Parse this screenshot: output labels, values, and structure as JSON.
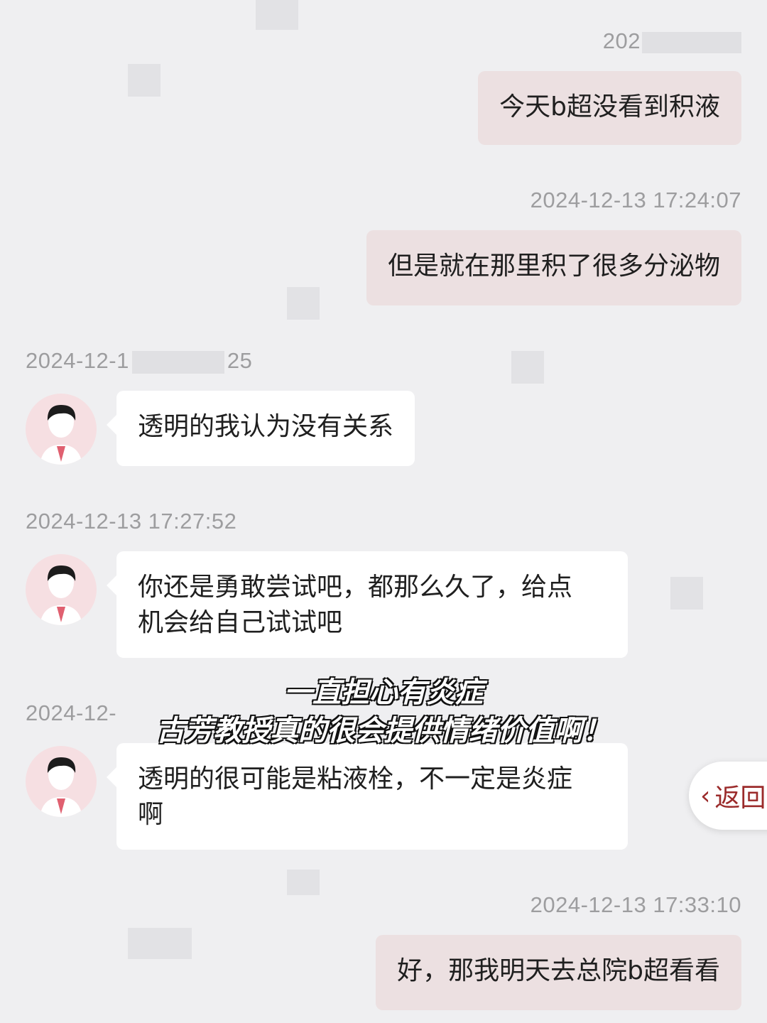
{
  "messages": [
    {
      "timestamp": "202",
      "side": "sent",
      "text": "今天b超没看到积液"
    },
    {
      "timestamp": "2024-12-13 17:24:07",
      "side": "sent",
      "text": "但是就在那里积了很多分泌物"
    },
    {
      "timestamp": "2024-12-1",
      "timestamp_tail": "25",
      "side": "received",
      "text": "透明的我认为没有关系"
    },
    {
      "timestamp": "2024-12-13 17:27:52",
      "side": "received",
      "lines": [
        "你还是勇敢尝试吧，都那么久了，给点",
        "机会给自己试试吧"
      ]
    },
    {
      "timestamp": "2024-12-",
      "side": "received",
      "lines": [
        "透明的很可能是粘液栓，不一定是炎症",
        "啊"
      ]
    },
    {
      "timestamp": "2024-12-13 17:33:10",
      "side": "sent",
      "text": "好，那我明天去总院b超看看"
    }
  ],
  "overlay": {
    "line1": "一直担心有炎症",
    "line2": "古芳教授真的很会提供情绪价值啊！"
  },
  "back_button": {
    "icon": "chevron-left-icon",
    "label": "返回"
  },
  "avatar_icon": "doctor-avatar-icon",
  "colors": {
    "background": "#efeff1",
    "sent_bubble": "#ece0e1",
    "received_bubble": "#ffffff",
    "timestamp_text": "#9d9d9f",
    "back_accent": "#9b2b2b"
  }
}
